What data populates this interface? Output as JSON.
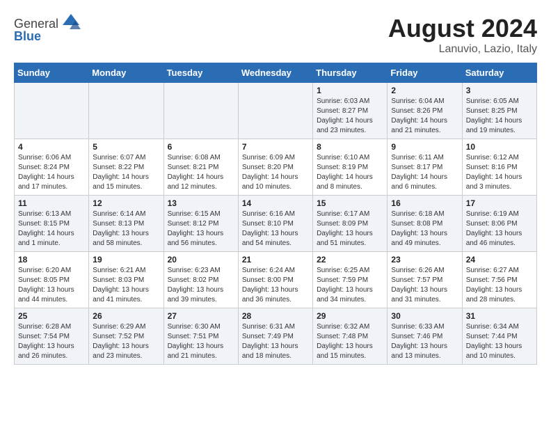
{
  "header": {
    "logo_general": "General",
    "logo_blue": "Blue",
    "month_year": "August 2024",
    "location": "Lanuvio, Lazio, Italy"
  },
  "weekdays": [
    "Sunday",
    "Monday",
    "Tuesday",
    "Wednesday",
    "Thursday",
    "Friday",
    "Saturday"
  ],
  "weeks": [
    [
      {
        "day": "",
        "info": ""
      },
      {
        "day": "",
        "info": ""
      },
      {
        "day": "",
        "info": ""
      },
      {
        "day": "",
        "info": ""
      },
      {
        "day": "1",
        "info": "Sunrise: 6:03 AM\nSunset: 8:27 PM\nDaylight: 14 hours and 23 minutes."
      },
      {
        "day": "2",
        "info": "Sunrise: 6:04 AM\nSunset: 8:26 PM\nDaylight: 14 hours and 21 minutes."
      },
      {
        "day": "3",
        "info": "Sunrise: 6:05 AM\nSunset: 8:25 PM\nDaylight: 14 hours and 19 minutes."
      }
    ],
    [
      {
        "day": "4",
        "info": "Sunrise: 6:06 AM\nSunset: 8:24 PM\nDaylight: 14 hours and 17 minutes."
      },
      {
        "day": "5",
        "info": "Sunrise: 6:07 AM\nSunset: 8:22 PM\nDaylight: 14 hours and 15 minutes."
      },
      {
        "day": "6",
        "info": "Sunrise: 6:08 AM\nSunset: 8:21 PM\nDaylight: 14 hours and 12 minutes."
      },
      {
        "day": "7",
        "info": "Sunrise: 6:09 AM\nSunset: 8:20 PM\nDaylight: 14 hours and 10 minutes."
      },
      {
        "day": "8",
        "info": "Sunrise: 6:10 AM\nSunset: 8:19 PM\nDaylight: 14 hours and 8 minutes."
      },
      {
        "day": "9",
        "info": "Sunrise: 6:11 AM\nSunset: 8:17 PM\nDaylight: 14 hours and 6 minutes."
      },
      {
        "day": "10",
        "info": "Sunrise: 6:12 AM\nSunset: 8:16 PM\nDaylight: 14 hours and 3 minutes."
      }
    ],
    [
      {
        "day": "11",
        "info": "Sunrise: 6:13 AM\nSunset: 8:15 PM\nDaylight: 14 hours and 1 minute."
      },
      {
        "day": "12",
        "info": "Sunrise: 6:14 AM\nSunset: 8:13 PM\nDaylight: 13 hours and 58 minutes."
      },
      {
        "day": "13",
        "info": "Sunrise: 6:15 AM\nSunset: 8:12 PM\nDaylight: 13 hours and 56 minutes."
      },
      {
        "day": "14",
        "info": "Sunrise: 6:16 AM\nSunset: 8:10 PM\nDaylight: 13 hours and 54 minutes."
      },
      {
        "day": "15",
        "info": "Sunrise: 6:17 AM\nSunset: 8:09 PM\nDaylight: 13 hours and 51 minutes."
      },
      {
        "day": "16",
        "info": "Sunrise: 6:18 AM\nSunset: 8:08 PM\nDaylight: 13 hours and 49 minutes."
      },
      {
        "day": "17",
        "info": "Sunrise: 6:19 AM\nSunset: 8:06 PM\nDaylight: 13 hours and 46 minutes."
      }
    ],
    [
      {
        "day": "18",
        "info": "Sunrise: 6:20 AM\nSunset: 8:05 PM\nDaylight: 13 hours and 44 minutes."
      },
      {
        "day": "19",
        "info": "Sunrise: 6:21 AM\nSunset: 8:03 PM\nDaylight: 13 hours and 41 minutes."
      },
      {
        "day": "20",
        "info": "Sunrise: 6:23 AM\nSunset: 8:02 PM\nDaylight: 13 hours and 39 minutes."
      },
      {
        "day": "21",
        "info": "Sunrise: 6:24 AM\nSunset: 8:00 PM\nDaylight: 13 hours and 36 minutes."
      },
      {
        "day": "22",
        "info": "Sunrise: 6:25 AM\nSunset: 7:59 PM\nDaylight: 13 hours and 34 minutes."
      },
      {
        "day": "23",
        "info": "Sunrise: 6:26 AM\nSunset: 7:57 PM\nDaylight: 13 hours and 31 minutes."
      },
      {
        "day": "24",
        "info": "Sunrise: 6:27 AM\nSunset: 7:56 PM\nDaylight: 13 hours and 28 minutes."
      }
    ],
    [
      {
        "day": "25",
        "info": "Sunrise: 6:28 AM\nSunset: 7:54 PM\nDaylight: 13 hours and 26 minutes."
      },
      {
        "day": "26",
        "info": "Sunrise: 6:29 AM\nSunset: 7:52 PM\nDaylight: 13 hours and 23 minutes."
      },
      {
        "day": "27",
        "info": "Sunrise: 6:30 AM\nSunset: 7:51 PM\nDaylight: 13 hours and 21 minutes."
      },
      {
        "day": "28",
        "info": "Sunrise: 6:31 AM\nSunset: 7:49 PM\nDaylight: 13 hours and 18 minutes."
      },
      {
        "day": "29",
        "info": "Sunrise: 6:32 AM\nSunset: 7:48 PM\nDaylight: 13 hours and 15 minutes."
      },
      {
        "day": "30",
        "info": "Sunrise: 6:33 AM\nSunset: 7:46 PM\nDaylight: 13 hours and 13 minutes."
      },
      {
        "day": "31",
        "info": "Sunrise: 6:34 AM\nSunset: 7:44 PM\nDaylight: 13 hours and 10 minutes."
      }
    ]
  ]
}
